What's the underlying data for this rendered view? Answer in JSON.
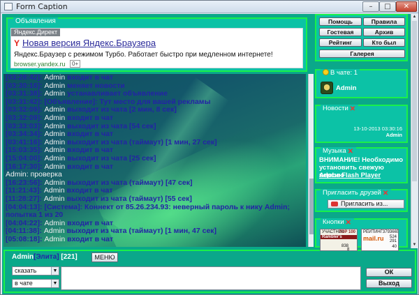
{
  "window": {
    "title": "Form Caption",
    "min": "–",
    "max": "□",
    "close": "✕"
  },
  "ads": {
    "legend": "Объявления",
    "tag": "Яндекс.Директ",
    "title": "Новая версия Яндекс.Браузера",
    "text": "Яндекс.Браузер с режимом Турбо. Работает быстро при медленном интернете!",
    "url": "browser.yandex.ru",
    "age_badge": "0+"
  },
  "chat": {
    "lines": [
      {
        "time": "[03:28:42]:",
        "nick": "Admin",
        "text": "входит в чат"
      },
      {
        "time": "[03:30:16]:",
        "nick": "Admin",
        "text": "меняет новости"
      },
      {
        "time": "[03:31:38]:",
        "nick": "Admin",
        "text": "устанавливает объявление"
      },
      {
        "time": "[03:31:42]:",
        "nick": "",
        "text": "[Объявление]: Тут место для вашей рекламы"
      },
      {
        "time": "[03:32:09]:",
        "nick": "Admin",
        "text": "выходит из чата [2 мин, 8 сек]"
      },
      {
        "time": "[03:32:09]:",
        "nick": "Admin",
        "text": "входит в чат"
      },
      {
        "time": "[03:33:03]:",
        "nick": "Admin",
        "text": "выходит из чата [54 сек]"
      },
      {
        "time": "[03:34:34]:",
        "nick": "Admin",
        "text": "входит в чат"
      },
      {
        "time": "[03:41:16]:",
        "nick": "Admin",
        "text": "выходит из чата (таймаут) [1 мин, 27 сек]"
      },
      {
        "time": "[15:03:35]:",
        "nick": "Admin",
        "text": "входит в чат"
      },
      {
        "time": "[15:04:00]:",
        "nick": "Admin",
        "text": "выходит из чата [25 сек]"
      },
      {
        "time": "[16:17:30]:",
        "nick": "Admin",
        "text": "входит в чат"
      },
      {
        "time": "",
        "nick": "Admin:",
        "text": "проверка",
        "plain": true
      },
      {
        "time": "[16:23:56]:",
        "nick": "Admin",
        "text": "выходит из чата (таймаут) [47 сек]"
      },
      {
        "time": "[11:21:43]:",
        "nick": "Admin",
        "text": "входит в чат"
      },
      {
        "time": "[11:28:27]:",
        "nick": "Admin",
        "text": "выходит из чата (таймаут) [55 сек]"
      },
      {
        "time": "[04:04:13]:",
        "nick": "",
        "text": "[Система]: Коннект от 85.26.234.93: неверный пароль к нику Admin; попытка 1 из 20",
        "wrap": true
      },
      {
        "time": "[04:04:22]:",
        "nick": "Admin",
        "text": "входит в чат"
      },
      {
        "time": "[04:11:38]:",
        "nick": "Admin",
        "text": "выходит из чата (таймаут) [1 мин, 47 сек]"
      },
      {
        "time": "[05:08:18]:",
        "nick": "Admin",
        "text": "входит в чат"
      }
    ]
  },
  "input": {
    "user": "Admin",
    "rank": "[Элита]",
    "count": "[221]",
    "menu_label": "МЕНЮ",
    "mode_select": "сказать",
    "scope_select": "в чате",
    "ok_label": "ОК",
    "exit_label": "Выход"
  },
  "nav": {
    "help": "Помощь",
    "rules": "Правила",
    "guestbook": "Гостевая",
    "archive": "Архив",
    "rating": "Рейтинг",
    "who_was": "Кто был",
    "gallery": "Галерея"
  },
  "in_chat": {
    "legend": "В чате: 1",
    "user": "Admin"
  },
  "news": {
    "legend": "Новости",
    "date": "13-10-2013 03:30:16",
    "author": "Admin"
  },
  "music": {
    "legend": "Музыка",
    "warning": "ВНИМАНИЕ! Необходимо установить свежую версию",
    "link": "Adobe Flash Player"
  },
  "invite": {
    "legend": "Пригласить друзей",
    "button": "Пригласить из..."
  },
  "buttons_panel": {
    "legend": "Кнопки",
    "banner1_line1": "УЧАСТНИК",
    "banner1_line2": "Rambler's",
    "banner1_top": "TOP 100",
    "banner2_line1": "РЕЙТИНГ",
    "banner2_num": "3793665",
    "banner2_brand": "mail.ru",
    "banner2_a": "524",
    "banner2_b": "291",
    "banner1_num": "838",
    "banner1_num2": "8",
    "banner2_c": "40"
  },
  "colors": {
    "panel_border": "#19f04a",
    "panel_bg": "#0cc2a6",
    "chat_time": "#2323a5"
  }
}
